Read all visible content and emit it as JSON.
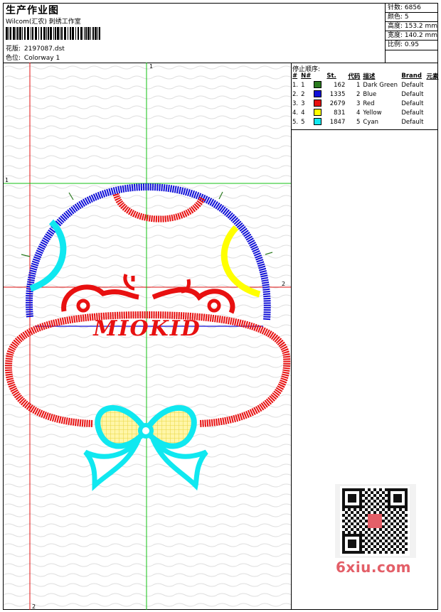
{
  "header": {
    "title": "生产作业图",
    "company": "Wilcom(汇农) 刺绣工作室",
    "design_label": "花版:",
    "design_value": "2197087.dst",
    "colorway_label": "色位:",
    "colorway_value": "Colorway 1"
  },
  "stats": {
    "stitches": "针数: 6856",
    "colors": "颜色: 5",
    "height": "高度: 153.2 mm",
    "width": "宽度: 140.2 mm",
    "scale": "比例: 0.95"
  },
  "stop_sequence": {
    "title": "停止顺序:",
    "headers": [
      "#",
      "N#",
      "St.",
      "代码",
      "描述",
      "Brand",
      "元素"
    ],
    "rows": [
      {
        "idx": "1.",
        "n": "1",
        "color": "#2a7a1e",
        "st": "162",
        "code": "1",
        "desc": "Dark Green",
        "brand": "Default"
      },
      {
        "idx": "2.",
        "n": "2",
        "color": "#1010d8",
        "st": "1335",
        "code": "2",
        "desc": "Blue",
        "brand": "Default"
      },
      {
        "idx": "3.",
        "n": "3",
        "color": "#e81010",
        "st": "2679",
        "code": "3",
        "desc": "Red",
        "brand": "Default"
      },
      {
        "idx": "4.",
        "n": "4",
        "color": "#ffff00",
        "st": "831",
        "code": "4",
        "desc": "Yellow",
        "brand": "Default"
      },
      {
        "idx": "5.",
        "n": "5",
        "color": "#10e8f0",
        "st": "1847",
        "code": "5",
        "desc": "Cyan",
        "brand": "Default"
      }
    ]
  },
  "canvas": {
    "guide_labels": [
      "1",
      "2",
      "1",
      "2"
    ],
    "embroidery_text": "MIOKID"
  },
  "watermark": {
    "text": "6xiu.com"
  }
}
